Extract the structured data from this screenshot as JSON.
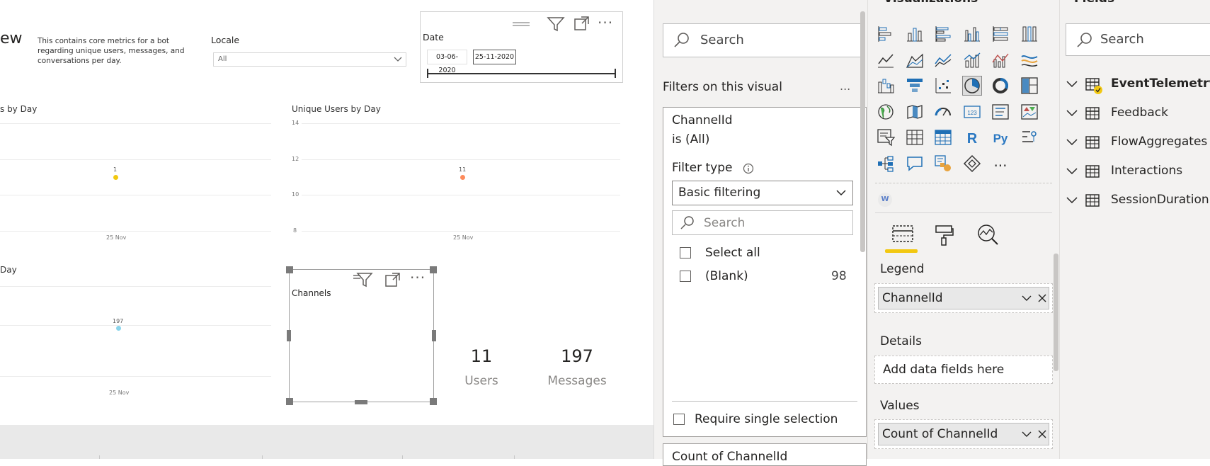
{
  "report": {
    "title_fragment": "ew",
    "description": "This contains core metrics for a bot regarding unique users, messages, and conversations per day.",
    "locale": {
      "label": "Locale",
      "value": "All"
    },
    "date_slicer": {
      "label": "Date",
      "start": "03-06-2020",
      "end": "25-11-2020"
    },
    "chart_left_top": {
      "title": "s by Day",
      "point_label": "1",
      "x_tick": "25 Nov",
      "point_color": "#F2C80F"
    },
    "chart_right_top": {
      "title": "Unique Users by Day",
      "y_ticks": [
        "14",
        "12",
        "10",
        "8"
      ],
      "point_label": "11",
      "x_tick": "25 Nov",
      "point_color": "#FD8B5C"
    },
    "chart_left_bottom": {
      "title": "Day",
      "point_label": "197",
      "x_tick": "25 Nov",
      "point_color": "#8AD4EB"
    },
    "channels_visual": {
      "title": "Channels"
    },
    "card_users": {
      "value": "11",
      "label": "Users"
    },
    "card_messages": {
      "value": "197",
      "label": "Messages"
    }
  },
  "filters": {
    "search_placeholder": "Search",
    "section_title": "Filters on this visual",
    "more": "...",
    "card": {
      "field": "ChannelId",
      "condition": "is (All)",
      "filter_type_label": "Filter type",
      "filter_type_value": "Basic filtering",
      "search_placeholder": "Search",
      "items": [
        {
          "label": "Select all",
          "count": ""
        },
        {
          "label": "(Blank)",
          "count": "98"
        }
      ],
      "require_single": "Require single selection"
    },
    "next_card_partial": "Count of ChannelId"
  },
  "visualizations": {
    "header_partial": "Visualizations",
    "more_glyph": "...",
    "wells": {
      "legend_label": "Legend",
      "legend_field": "ChannelId",
      "details_label": "Details",
      "details_placeholder": "Add data fields here",
      "values_label": "Values",
      "values_field": "Count of ChannelId"
    },
    "r_label": "R",
    "py_label": "Py",
    "w_label": "W",
    "num_label": "123",
    "accent": "#F2C811"
  },
  "fields": {
    "header_partial": "Fields",
    "search_placeholder": "Search",
    "tables": [
      {
        "name": "EventTelemetry",
        "active": true
      },
      {
        "name": "Feedback",
        "active": false
      },
      {
        "name": "FlowAggregates",
        "active": false
      },
      {
        "name": "Interactions",
        "active": false
      },
      {
        "name": "SessionDuration",
        "active": false
      }
    ]
  }
}
